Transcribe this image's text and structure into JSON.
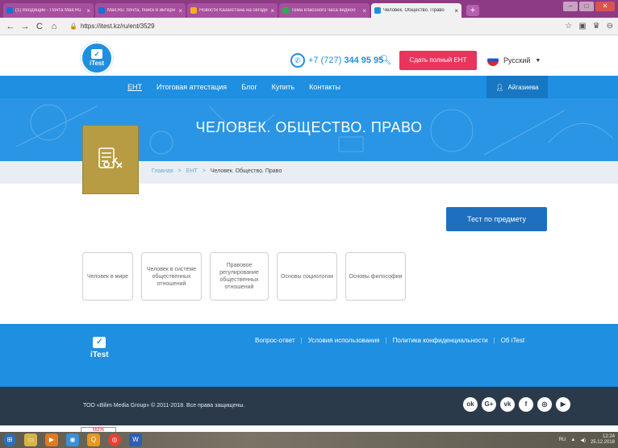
{
  "browser": {
    "tabs": [
      {
        "label": "(1) Входящие - Почта Mail.Ru",
        "favicon_color": "#1a6fd0",
        "active": false
      },
      {
        "label": "Mail.Ru: почта, поиск в интерн",
        "favicon_color": "#1a6fd0",
        "active": false
      },
      {
        "label": "Новости Казахстана на сегодн",
        "favicon_color": "#f2b01e",
        "active": false
      },
      {
        "label": "Тема классного часа видеоо",
        "favicon_color": "#35a853",
        "active": false
      },
      {
        "label": "Человек. Общество. Право",
        "favicon_color": "#1e8fe1",
        "active": true
      }
    ],
    "tab_close": "×",
    "new_tab": "+",
    "url": "https://itest.kz/ru/ent/3529",
    "nav": {
      "back": "←",
      "forward": "→",
      "reload": "C",
      "home": "⌂"
    },
    "right_icons": [
      "☆",
      "▣",
      "♛",
      "⊖"
    ]
  },
  "header": {
    "logo_text": "iTest",
    "phone_prefix": "+7 (727)",
    "phone_number": "344 95 95",
    "cta_label": "Сдать полный ЕНТ",
    "language": "Русский"
  },
  "nav": {
    "items": [
      "ЕНТ",
      "Итоговая аттестация",
      "Блог",
      "Купить",
      "Контакты"
    ],
    "user": "Айгазиева"
  },
  "hero": {
    "title": "ЧЕЛОВЕК. ОБЩЕСТВО. ПРАВО"
  },
  "breadcrumb": {
    "items": [
      "Главная",
      "ЕНТ",
      "Человек. Общество. Право"
    ],
    "separator": ">"
  },
  "main": {
    "test_button": "Тест по предмету",
    "cards": [
      "Человек в мире",
      "Человек в системе общественных отношений",
      "Правовое регулирование общественных отношений",
      "Основы социологии",
      "Основы философии"
    ]
  },
  "footer": {
    "logo_text": "iTest",
    "links": [
      "Вопрос-ответ",
      "Условия использования",
      "Политика конфиденциальности",
      "Об iTest"
    ],
    "copyright": "ТОО «Bilim Media Group» © 2011-2018. Все права защищены.",
    "socials": [
      "ok",
      "G+",
      "vk",
      "f",
      "ig",
      "yt"
    ],
    "counter": "55276"
  },
  "taskbar": {
    "lang": "RU",
    "time": "12:24",
    "date": "25.12.2018"
  },
  "colors": {
    "brand_blue": "#1e8fe1",
    "cta_red": "#e8355d",
    "tile_gold": "#b79c43",
    "footer_dark": "#2b3a4b"
  }
}
